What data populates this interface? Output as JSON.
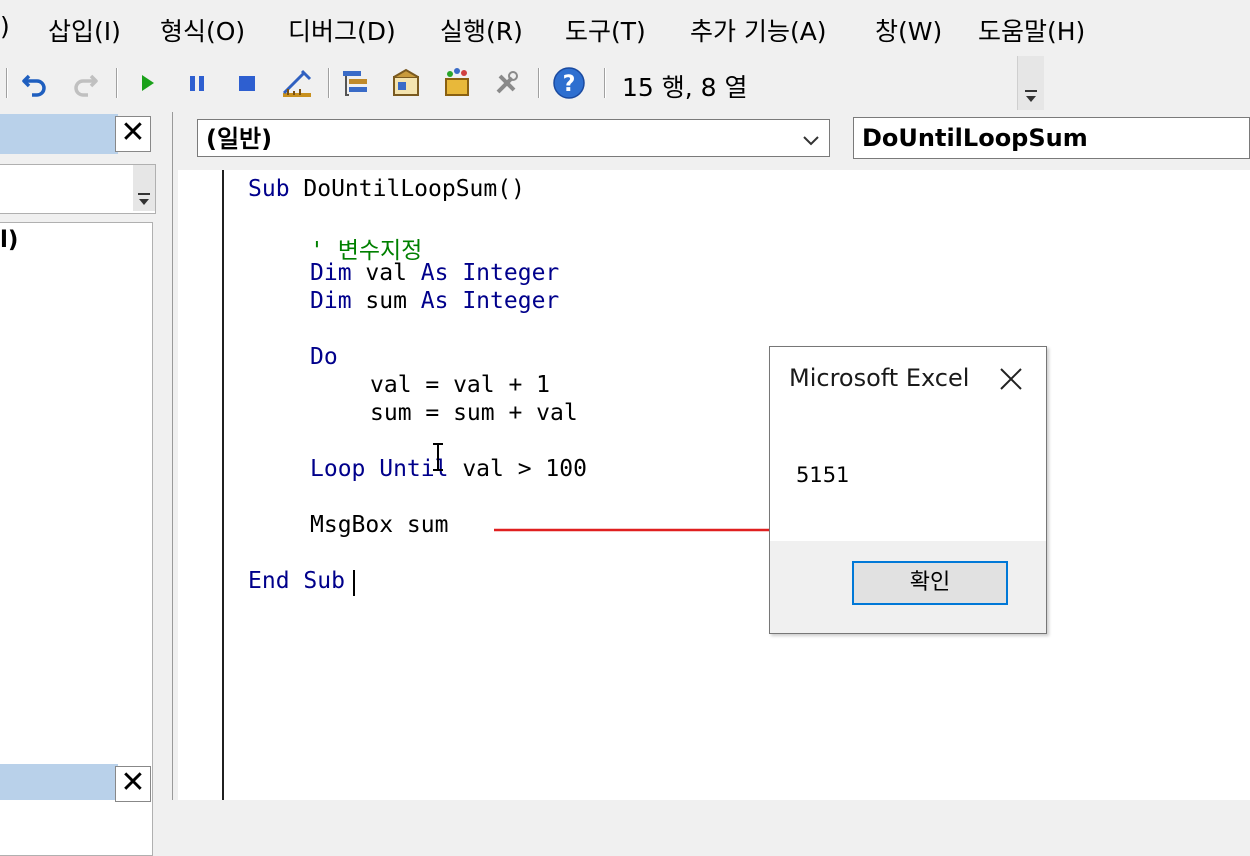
{
  "menu": {
    "cut_paren": ")",
    "insert": "삽입(I)",
    "format": "형식(O)",
    "debug": "디버그(D)",
    "run": "실행(R)",
    "tools": "도구(T)",
    "addins": "추가 기능(A)",
    "window": "창(W)",
    "help": "도움말(H)"
  },
  "toolbar": {
    "position": "15 행, 8 열",
    "icons": [
      "undo-icon",
      "redo-icon",
      "run-icon",
      "break-icon",
      "reset-icon",
      "design-mode-icon",
      "project-explorer-icon",
      "properties-icon",
      "object-browser-icon",
      "toolbox-icon",
      "help-icon"
    ]
  },
  "left_panel": {
    "close_glyph": "✕",
    "tree_partial_text": "l)"
  },
  "code_window": {
    "object_combo": "(일반)",
    "procedure_combo": "DoUntilLoopSum",
    "lines": {
      "l1_kw": "Sub",
      "l1_rest": " DoUntilLoopSum()",
      "l2_comment": "' 변수지정",
      "l3_kw1": "Dim",
      "l3_mid": " val ",
      "l3_kw2": "As Integer",
      "l4_kw1": "Dim",
      "l4_mid": " sum ",
      "l4_kw2": "As Integer",
      "l5_kw": "Do",
      "l6": "val = val + 1",
      "l7": "sum = sum + val",
      "l8_kw": "Loop Until",
      "l8_rest": " val > 100",
      "l9": "MsgBox sum",
      "l10_kw": "End Sub"
    }
  },
  "dialog": {
    "title": "Microsoft Excel",
    "message": "5151",
    "ok": "확인"
  },
  "colors": {
    "keyword": "#00008b",
    "comment": "#008000",
    "arrow": "#e02020",
    "dialog_button_border": "#0078d7"
  }
}
